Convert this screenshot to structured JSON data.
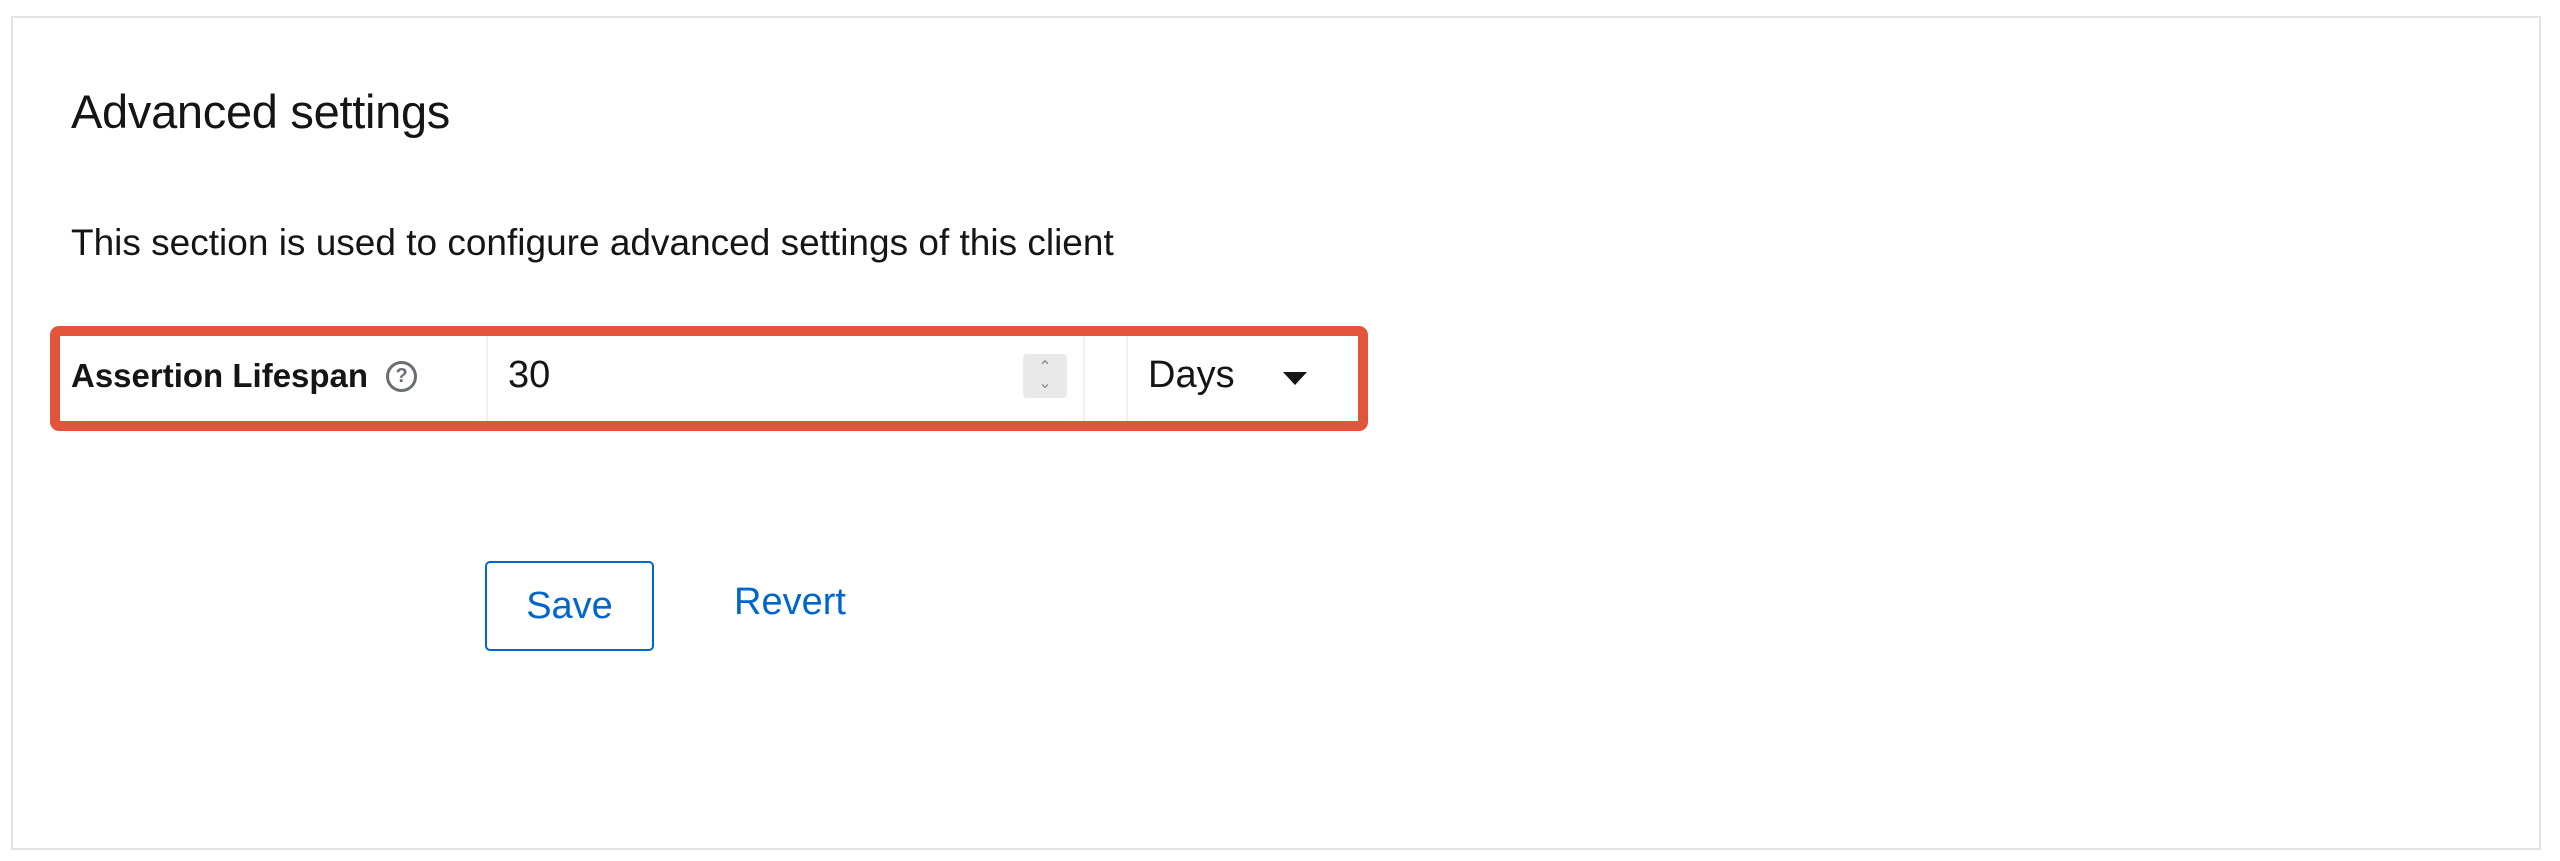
{
  "section": {
    "title": "Advanced settings",
    "description": "This section is used to configure advanced settings of this client"
  },
  "assertion_lifespan": {
    "label": "Assertion Lifespan",
    "help_icon": "help-circle-icon",
    "value": "30",
    "unit": "Days",
    "highlight_color": "#e3553a"
  },
  "actions": {
    "save_label": "Save",
    "revert_label": "Revert",
    "accent_color": "#0066cc"
  }
}
